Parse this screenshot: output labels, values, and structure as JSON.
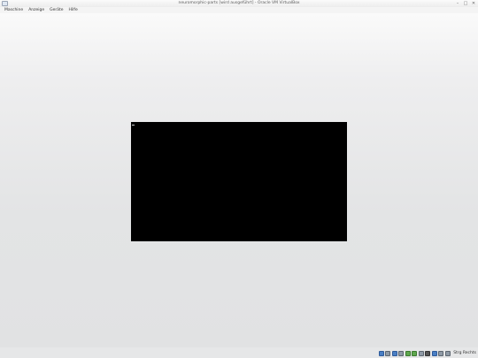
{
  "window": {
    "title": "neuromorphic-parts [wird ausgeführt] - Oracle VM VirtualBox",
    "controls": [
      "minimize",
      "maximize",
      "close"
    ]
  },
  "menubar": {
    "items": [
      {
        "label": "Maschine"
      },
      {
        "label": "Anzeige"
      },
      {
        "label": "Geräte"
      },
      {
        "label": "Hilfe"
      }
    ]
  },
  "vm": {
    "screen_color": "#000000",
    "console_cursor": "_"
  },
  "statusbar": {
    "icons": [
      "hard-disk-icon",
      "optical-drive-icon",
      "usb-icon",
      "shared-folders-icon",
      "network-icon",
      "network-icon",
      "usb-device-icon",
      "display-icon",
      "mouse-integration-icon",
      "keyboard-capture-icon",
      "arrow-down-icon"
    ],
    "host_key_label": "Strg Rechts"
  },
  "colors": {
    "background": "#e3e4e5",
    "vm_screen": "#000000"
  }
}
